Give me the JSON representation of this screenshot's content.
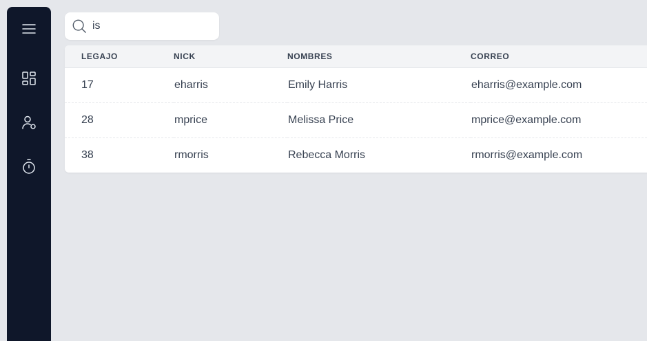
{
  "sidebar": {
    "items": [
      {
        "icon": "menu-icon"
      },
      {
        "icon": "dashboard-icon"
      },
      {
        "icon": "users-icon"
      },
      {
        "icon": "timer-icon"
      }
    ]
  },
  "search": {
    "value": "is",
    "icon": "search-icon"
  },
  "table": {
    "headers": [
      "LEGAJO",
      "NICK",
      "NOMBRES",
      "CORREO"
    ],
    "rows": [
      {
        "legajo": "17",
        "nick": "eharris",
        "nombres": "Emily Harris",
        "correo": "eharris@example.com"
      },
      {
        "legajo": "28",
        "nick": "mprice",
        "nombres": "Melissa Price",
        "correo": "mprice@example.com"
      },
      {
        "legajo": "38",
        "nick": "rmorris",
        "nombres": "Rebecca Morris",
        "correo": "rmorris@example.com"
      }
    ]
  }
}
